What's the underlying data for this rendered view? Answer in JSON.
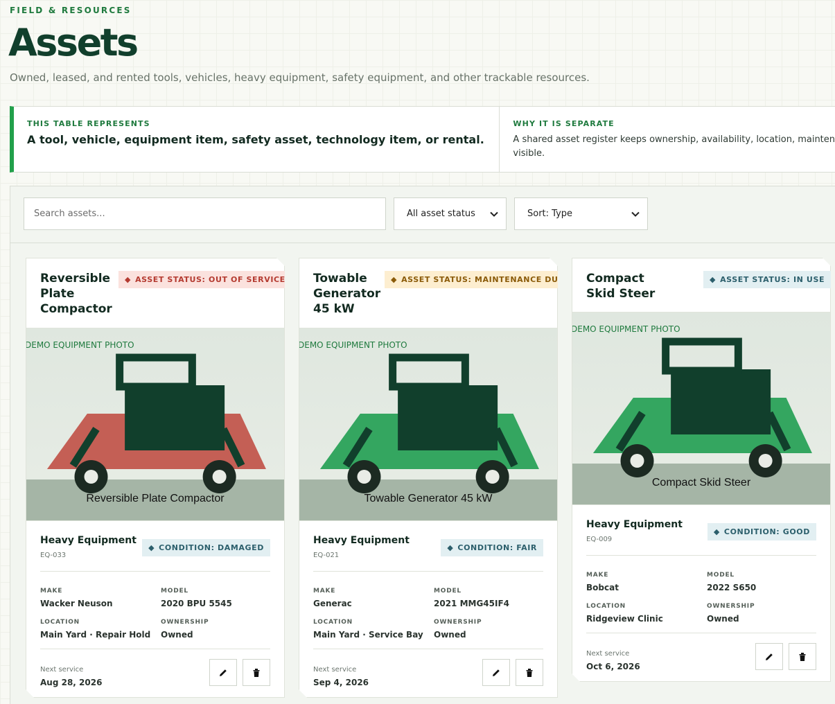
{
  "header": {
    "eyebrow": "FIELD & RESOURCES",
    "title": "Assets",
    "subtitle": "Owned, leased, and rented tools, vehicles, heavy equipment, safety equipment, and other trackable resources."
  },
  "info": {
    "represents_label": "THIS TABLE REPRESENTS",
    "represents_value": "A tool, vehicle, equipment item, safety asset, technology item, or rental.",
    "separate_label": "WHY IT IS SEPARATE",
    "separate_line1": "A shared asset register keeps ownership, availability, location, maintena",
    "separate_line2": "visible."
  },
  "toolbar": {
    "search_placeholder": "Search assets...",
    "status_filter": "All asset status",
    "sort": "Sort: Type"
  },
  "labels": {
    "make": "MAKE",
    "model": "MODEL",
    "location": "LOCATION",
    "ownership": "OWNERSHIP",
    "next_service": "Next service",
    "photo_tag": "DEMO EQUIPMENT PHOTO"
  },
  "colors": {
    "accent": "#22a04b",
    "brand_dark": "#113f2c",
    "status_red": "#b43a30",
    "status_amber": "#8a5a08",
    "status_blue": "#2c5f6c"
  },
  "assets": [
    {
      "name": "Reversible Plate Compactor",
      "status": "ASSET STATUS: OUT OF SERVICE",
      "status_color": "#b43a30",
      "body_color": "#c45f55",
      "category": "Heavy Equipment",
      "id": "EQ-033",
      "condition": "CONDITION: DAMAGED",
      "make": "Wacker Neuson",
      "model": "2020 BPU 5545",
      "location": "Main Yard · Repair Hold",
      "ownership": "Owned",
      "next_service": "Aug 28, 2026"
    },
    {
      "name": "Towable Generator 45 kW",
      "status": "ASSET STATUS: MAINTENANCE DUE",
      "status_color": "#8a5a08",
      "body_color": "#34a660",
      "category": "Heavy Equipment",
      "id": "EQ-021",
      "condition": "CONDITION: FAIR",
      "make": "Generac",
      "model": "2021 MMG45IF4",
      "location": "Main Yard · Service Bay",
      "ownership": "Owned",
      "next_service": "Sep 4, 2026"
    },
    {
      "name": "Compact Skid Steer",
      "status": "ASSET STATUS: IN USE",
      "status_color": "#2c5f6c",
      "body_color": "#34a660",
      "category": "Heavy Equipment",
      "id": "EQ-009",
      "condition": "CONDITION: GOOD",
      "make": "Bobcat",
      "model": "2022 S650",
      "location": "Ridgeview Clinic",
      "ownership": "Owned",
      "next_service": "Oct 6, 2026"
    }
  ]
}
